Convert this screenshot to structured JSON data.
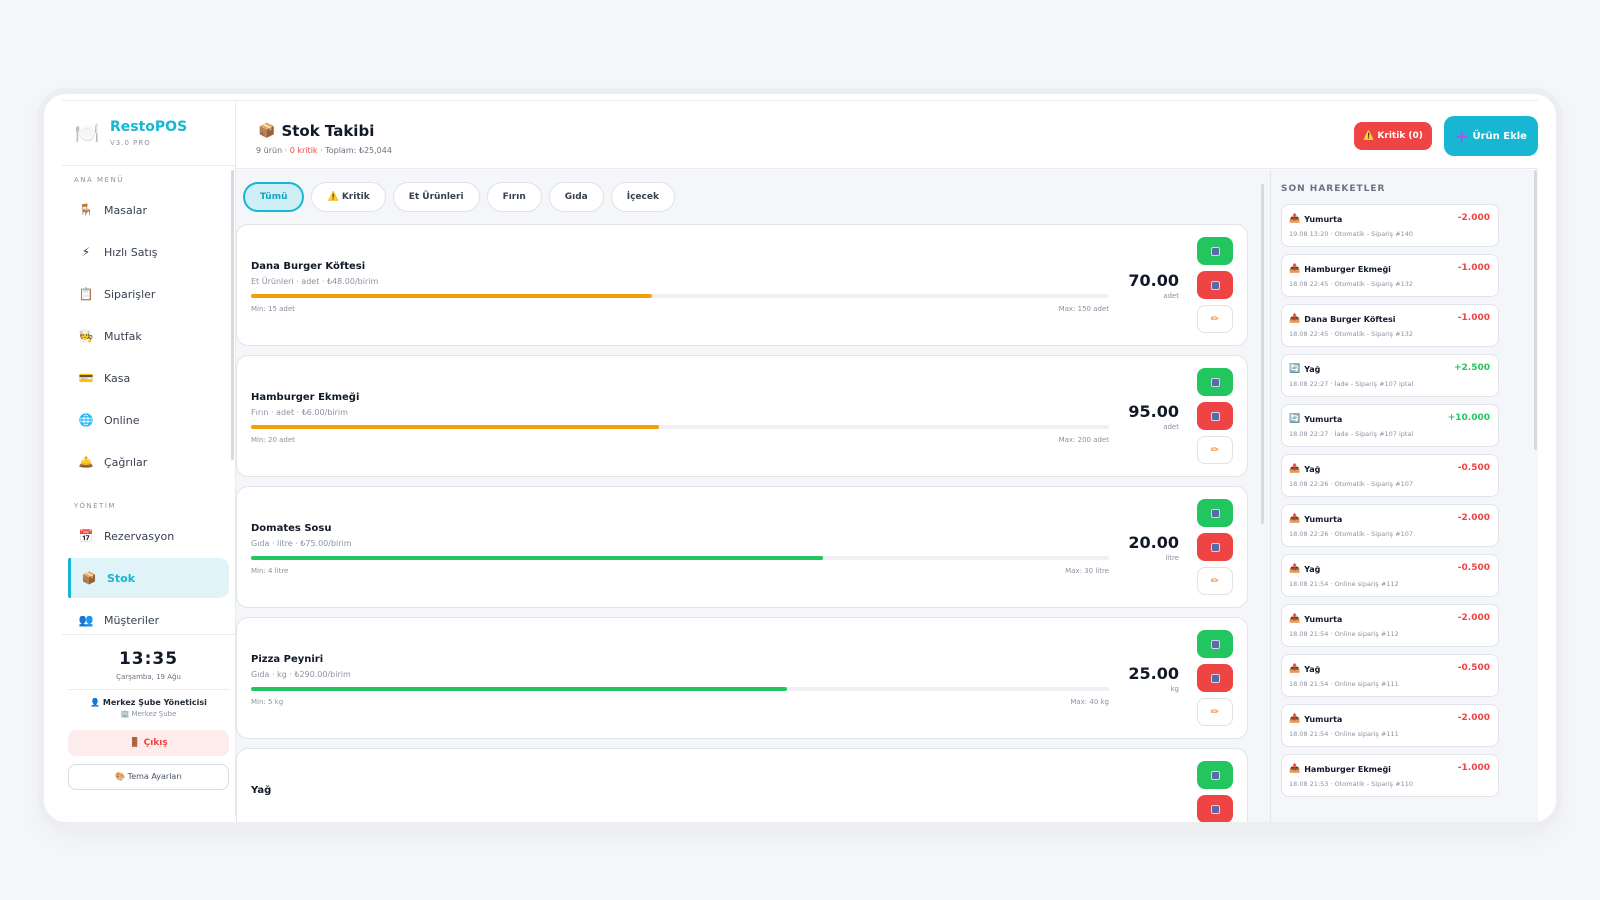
{
  "brand": {
    "name": "RestoPOS",
    "version": "V3.0 PRO",
    "logo_icon": "🍽️"
  },
  "sidebar": {
    "section_main": "ANA MENÜ",
    "section_admin": "YÖNETİM",
    "items": [
      {
        "label": "Masalar",
        "icon": "🪑"
      },
      {
        "label": "Hızlı Satış",
        "icon": "⚡"
      },
      {
        "label": "Siparişler",
        "icon": "📋"
      },
      {
        "label": "Mutfak",
        "icon": "🧑‍🍳"
      },
      {
        "label": "Kasa",
        "icon": "💳"
      },
      {
        "label": "Online",
        "icon": "🌐"
      },
      {
        "label": "Çağrılar",
        "icon": "🛎️"
      }
    ],
    "admin_items": [
      {
        "label": "Rezervasyon",
        "icon": "📅"
      },
      {
        "label": "Stok",
        "icon": "📦",
        "active": true
      },
      {
        "label": "Müşteriler",
        "icon": "👥"
      }
    ],
    "clock": "13:35",
    "date": "Çarşamba, 19 Ağu",
    "user": {
      "name": "👤 Merkez Şube Yöneticisi",
      "branch": "🏢 Merkez Şube"
    },
    "logout_label": "🚪 Çıkış",
    "theme_label": "🎨 Tema Ayarları"
  },
  "header": {
    "title_icon": "📦",
    "title": "Stok Takibi",
    "sub_count": "9 ürün",
    "sub_critical": "0 kritik",
    "sub_total": "Toplam: ₺25,044",
    "critical_button": "⚠️ Kritik (0)",
    "add_button": "Ürün Ekle"
  },
  "filters": [
    {
      "label": "Tümü",
      "active": true
    },
    {
      "label": "⚠️ Kritik"
    },
    {
      "label": "Et Ürünleri"
    },
    {
      "label": "Fırın"
    },
    {
      "label": "Gıda"
    },
    {
      "label": "İçecek"
    }
  ],
  "products": [
    {
      "name": "Dana Burger Köftesi",
      "meta": "Et Ürünleri · adet · ₺48.00/birim",
      "qty": "70.00",
      "unit": "adet",
      "min": "Min: 15 adet",
      "max": "Max: 150 adet",
      "level": 0.467,
      "color": "#f59e0b"
    },
    {
      "name": "Hamburger Ekmeği",
      "meta": "Fırın · adet · ₺6.00/birim",
      "qty": "95.00",
      "unit": "adet",
      "min": "Min: 20 adet",
      "max": "Max: 200 adet",
      "level": 0.475,
      "color": "#f59e0b"
    },
    {
      "name": "Domates Sosu",
      "meta": "Gıda · litre · ₺75.00/birim",
      "qty": "20.00",
      "unit": "litre",
      "min": "Min: 4 litre",
      "max": "Max: 30 litre",
      "level": 0.667,
      "color": "#22c55e"
    },
    {
      "name": "Pizza Peyniri",
      "meta": "Gıda · kg · ₺290.00/birim",
      "qty": "25.00",
      "unit": "kg",
      "min": "Min: 5 kg",
      "max": "Max: 40 kg",
      "level": 0.625,
      "color": "#22c55e"
    },
    {
      "name": "Yağ",
      "meta": "",
      "qty": "",
      "unit": "",
      "min": "",
      "max": "",
      "level": 0,
      "color": "#22c55e"
    }
  ],
  "movements_title": "SON HAREKETLER",
  "movements": [
    {
      "name": "Yumurta",
      "detail": "19.08 13:20 · Otomatik - Sipariş #140",
      "value": "-2.000",
      "type": "neg",
      "icon": "📤"
    },
    {
      "name": "Hamburger Ekmeği",
      "detail": "18.08 22:45 · Otomatik - Sipariş #132",
      "value": "-1.000",
      "type": "neg",
      "icon": "📤"
    },
    {
      "name": "Dana Burger Köftesi",
      "detail": "18.08 22:45 · Otomatik - Sipariş #132",
      "value": "-1.000",
      "type": "neg",
      "icon": "📤"
    },
    {
      "name": "Yağ",
      "detail": "18.08 22:27 · İade - Sipariş #107 iptal",
      "value": "+2.500",
      "type": "pos",
      "icon": "🔄"
    },
    {
      "name": "Yumurta",
      "detail": "18.08 22:27 · İade - Sipariş #107 iptal",
      "value": "+10.000",
      "type": "pos",
      "icon": "🔄"
    },
    {
      "name": "Yağ",
      "detail": "18.08 22:26 · Otomatik - Sipariş #107",
      "value": "-0.500",
      "type": "neg",
      "icon": "📤"
    },
    {
      "name": "Yumurta",
      "detail": "18.08 22:26 · Otomatik - Sipariş #107",
      "value": "-2.000",
      "type": "neg",
      "icon": "📤"
    },
    {
      "name": "Yağ",
      "detail": "18.08 21:54 · Online sipariş #112",
      "value": "-0.500",
      "type": "neg",
      "icon": "📤"
    },
    {
      "name": "Yumurta",
      "detail": "18.08 21:54 · Online sipariş #112",
      "value": "-2.000",
      "type": "neg",
      "icon": "📤"
    },
    {
      "name": "Yağ",
      "detail": "18.08 21:54 · Online sipariş #111",
      "value": "-0.500",
      "type": "neg",
      "icon": "📤"
    },
    {
      "name": "Yumurta",
      "detail": "18.08 21:54 · Online sipariş #111",
      "value": "-2.000",
      "type": "neg",
      "icon": "📤"
    },
    {
      "name": "Hamburger Ekmeği",
      "detail": "18.08 21:53 · Otomatik - Sipariş #110",
      "value": "-1.000",
      "type": "neg",
      "icon": "📤"
    }
  ]
}
